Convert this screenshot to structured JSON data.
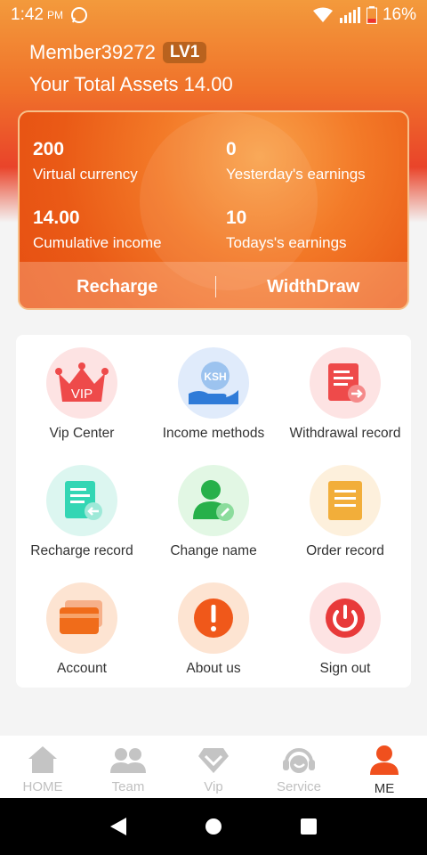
{
  "status_bar": {
    "time": "1:42",
    "ampm": "PM",
    "battery": "16%"
  },
  "member": {
    "name": "Member39272",
    "level": "LV1"
  },
  "assets": {
    "text": "Your Total Assets 14.00"
  },
  "stats": {
    "virtual_currency": {
      "value": "200",
      "label": "Virtual currency"
    },
    "yesterday": {
      "value": "0",
      "label": "Yesterday's earnings"
    },
    "cumulative": {
      "value": "14.00",
      "label": "Cumulative income"
    },
    "today": {
      "value": "10",
      "label": "Todays's earnings"
    }
  },
  "actions": {
    "recharge": "Recharge",
    "withdraw": "WidthDraw"
  },
  "menu": [
    {
      "label": "Vip Center"
    },
    {
      "label": "Income methods"
    },
    {
      "label": "Withdrawal record"
    },
    {
      "label": "Recharge record"
    },
    {
      "label": "Change name"
    },
    {
      "label": "Order record"
    },
    {
      "label": "Account"
    },
    {
      "label": "About us"
    },
    {
      "label": "Sign out"
    }
  ],
  "icon_text": {
    "vip": "VIP",
    "ksh": "KSH"
  },
  "tabs": [
    {
      "label": "HOME"
    },
    {
      "label": "Team"
    },
    {
      "label": "Vip"
    },
    {
      "label": "Service"
    },
    {
      "label": "ME"
    }
  ],
  "colors": {
    "accent": "#f0722a",
    "active_tab": "#f0501e",
    "inactive_tab": "#c0c0c0"
  }
}
